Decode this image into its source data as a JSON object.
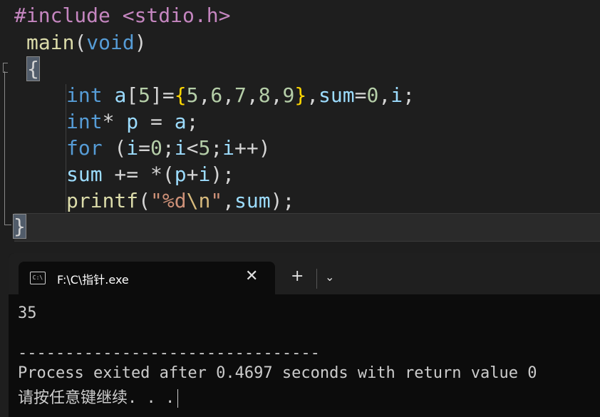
{
  "editor": {
    "include": "#include <stdio.h>",
    "main_name": "main",
    "main_args": "void",
    "open_brace": "{",
    "close_brace": "}",
    "lines": {
      "l1_type": "int",
      "l1_a": "a",
      "l1_size": "5",
      "l1_vals": [
        "5",
        "6",
        "7",
        "8",
        "9"
      ],
      "l1_sum": "sum",
      "l1_zero": "0",
      "l1_i": "i",
      "l2_type": "int",
      "l2_p": "p",
      "l2_a": "a",
      "l3_for": "for",
      "l3_i1": "i",
      "l3_zero": "0",
      "l3_i2": "i",
      "l3_five": "5",
      "l3_i3": "i",
      "l4_sum": "sum",
      "l4_p": "p",
      "l4_i": "i",
      "l5_printf": "printf",
      "l5_fmt": "%d",
      "l5_esc": "\\n",
      "l5_sum": "sum"
    }
  },
  "terminal": {
    "tab_title": "F:\\C\\指针.exe",
    "tab_icon": "C:\\",
    "close_icon": "✕",
    "new_tab_icon": "+",
    "dropdown_icon": "⌄",
    "output": "35",
    "divider": "--------------------------------",
    "process_line": "Process exited after 0.4697 seconds with return value 0",
    "continue_line": "请按任意键继续. . ."
  }
}
